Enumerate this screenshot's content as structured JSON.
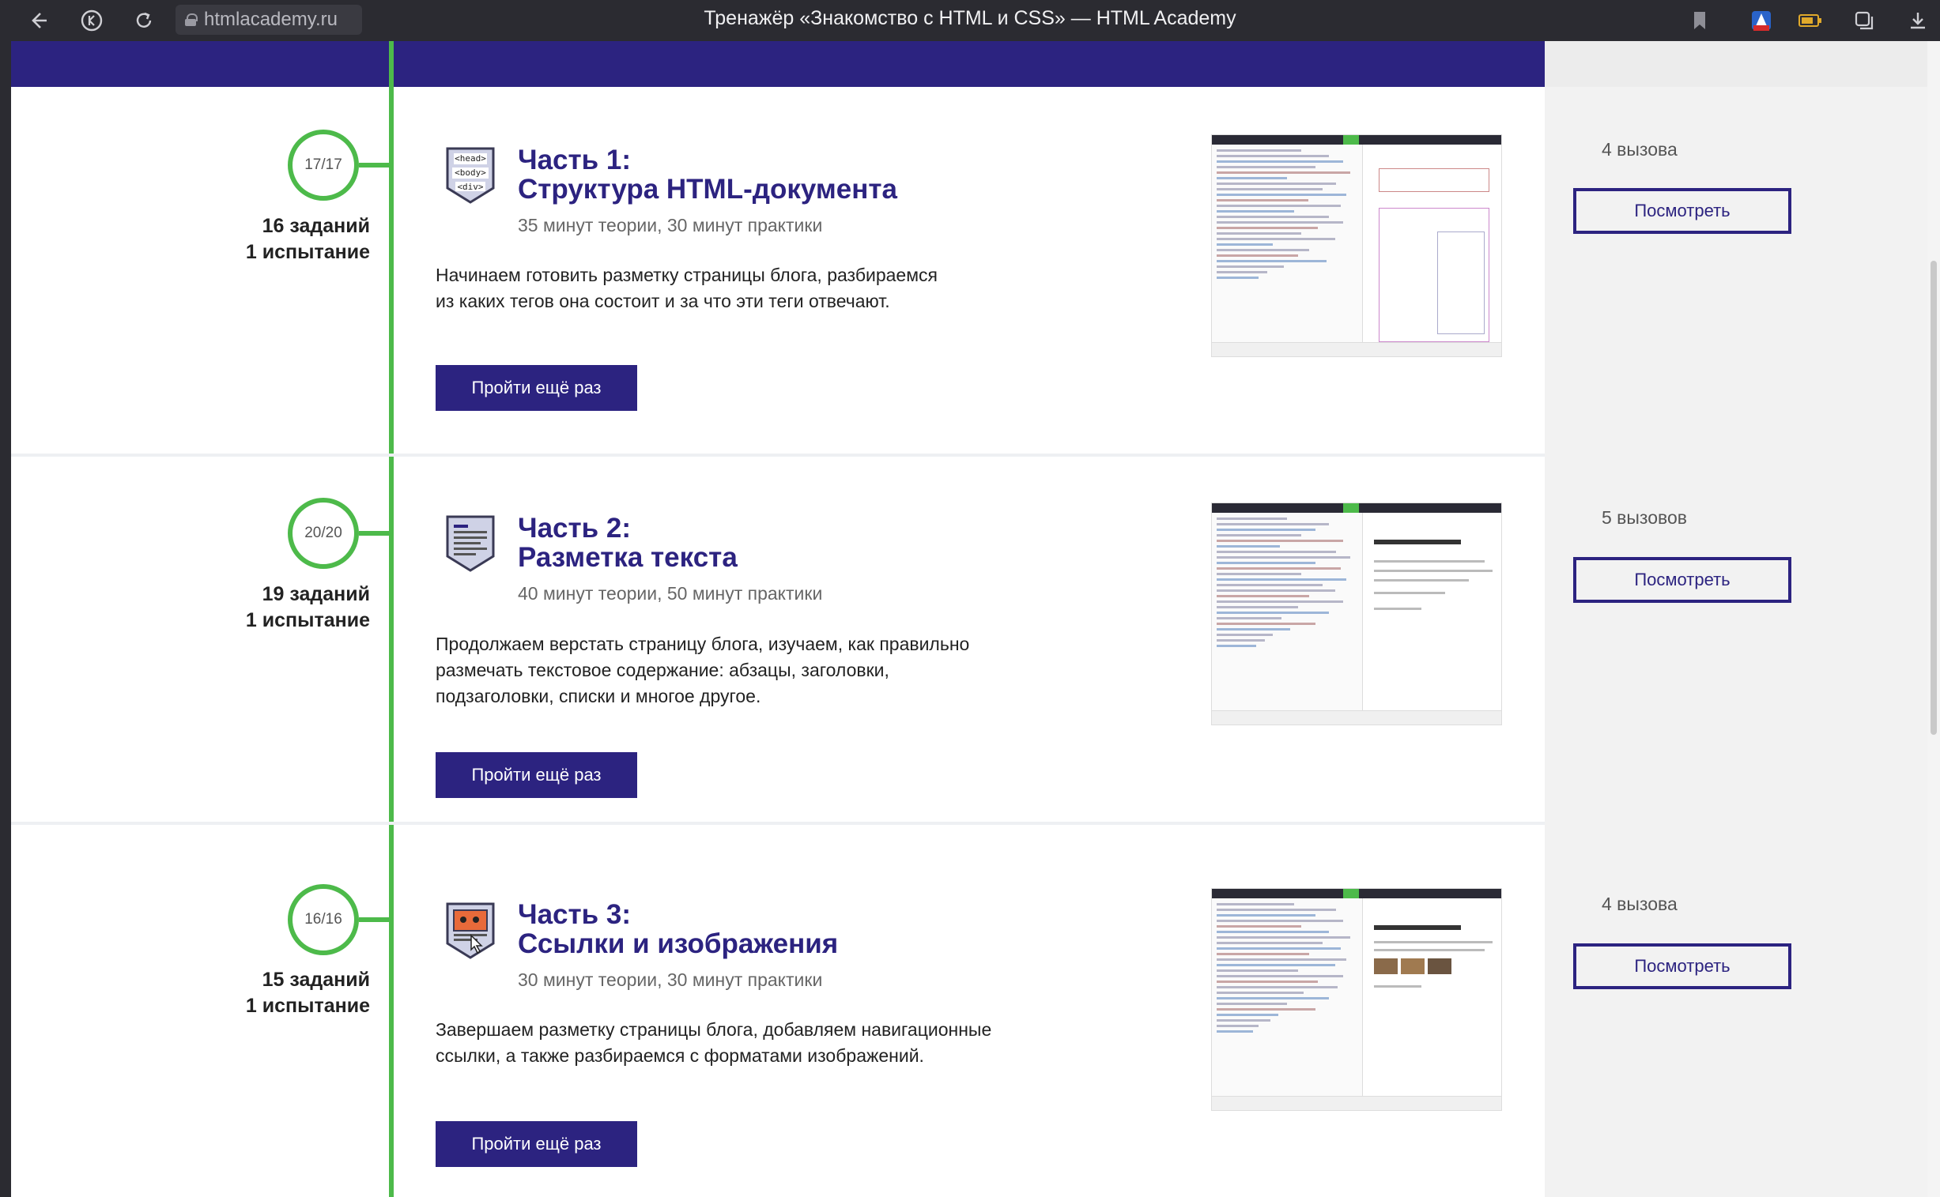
{
  "browser": {
    "url": "htmlacademy.ru",
    "title": "Тренажёр «Знакомство с HTML и CSS» — HTML Academy"
  },
  "colors": {
    "accent": "#2c2380",
    "timeline": "#4dba4a"
  },
  "parts": [
    {
      "progress": "17/17",
      "tasks": "16 заданий",
      "trials": "1 испытание",
      "icon": "html-tags-badge-icon",
      "badge_lines": [
        "<head>",
        "<body>",
        "<div>"
      ],
      "title_line1": "Часть 1:",
      "title_line2": "Структура HTML-документа",
      "duration": "35 минут теории, 30 минут практики",
      "desc_line1": "Начинаем готовить разметку страницы блога, разбираемся",
      "desc_line2": "из каких тегов она состоит и за что эти теги отвечают.",
      "desc_line3": "",
      "button": "Пройти ещё раз",
      "calls": "4 вызова",
      "view_button": "Посмотреть"
    },
    {
      "progress": "20/20",
      "tasks": "19 заданий",
      "trials": "1 испытание",
      "icon": "text-document-badge-icon",
      "title_line1": "Часть 2:",
      "title_line2": "Разметка текста",
      "duration": "40 минут теории, 50 минут практики",
      "desc_line1": "Продолжаем верстать страницу блога, изучаем, как правильно",
      "desc_line2": "размечать текстовое содержание: абзацы, заголовки,",
      "desc_line3": "подзаголовки, списки и многое другое.",
      "button": "Пройти ещё раз",
      "calls": "5 вызовов",
      "view_button": "Посмотреть"
    },
    {
      "progress": "16/16",
      "tasks": "15 заданий",
      "trials": "1 испытание",
      "icon": "image-link-badge-icon",
      "title_line1": "Часть 3:",
      "title_line2": "Ссылки и изображения",
      "duration": "30 минут теории, 30 минут практики",
      "desc_line1": "Завершаем разметку страницы блога, добавляем навигационные",
      "desc_line2": "ссылки, а также разбираемся с форматами изображений.",
      "desc_line3": "",
      "button": "Пройти ещё раз",
      "calls": "4 вызова",
      "view_button": "Посмотреть"
    }
  ]
}
